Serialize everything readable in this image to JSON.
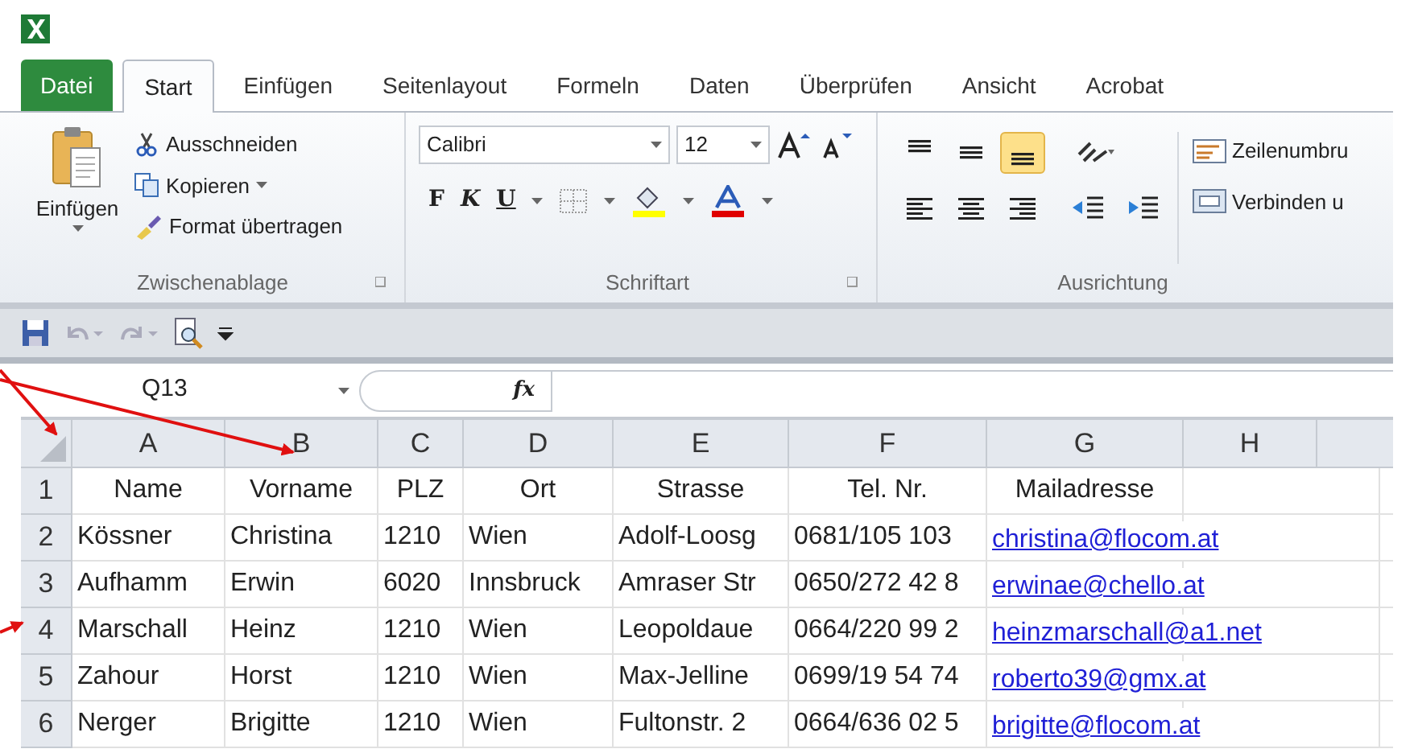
{
  "tabs": [
    {
      "label": "Datei",
      "kind": "file",
      "selected": false
    },
    {
      "label": "Start",
      "kind": "tab",
      "selected": true
    },
    {
      "label": "Einfügen",
      "kind": "tab",
      "selected": false
    },
    {
      "label": "Seitenlayout",
      "kind": "tab",
      "selected": false
    },
    {
      "label": "Formeln",
      "kind": "tab",
      "selected": false
    },
    {
      "label": "Daten",
      "kind": "tab",
      "selected": false
    },
    {
      "label": "Überprüfen",
      "kind": "tab",
      "selected": false
    },
    {
      "label": "Ansicht",
      "kind": "tab",
      "selected": false
    },
    {
      "label": "Acrobat",
      "kind": "tab",
      "selected": false
    }
  ],
  "clipboard": {
    "paste": "Einfügen",
    "cut": "Ausschneiden",
    "copy": "Kopieren",
    "format_painter": "Format übertragen",
    "label": "Zwischenablage"
  },
  "font": {
    "name": "Calibri",
    "size": "12",
    "bold": "F",
    "italic": "K",
    "underline": "U",
    "label": "Schriftart"
  },
  "alignment": {
    "vertical": [
      {
        "kind": "top",
        "selected": false
      },
      {
        "kind": "middle",
        "selected": false
      },
      {
        "kind": "bottom",
        "selected": true
      }
    ],
    "wrap": "Zeilenumbru",
    "merge": "Verbinden u",
    "label": "Ausrichtung"
  },
  "formula_bar": {
    "name_box": "Q13",
    "function_label": "fx"
  },
  "columns": [
    "A",
    "B",
    "C",
    "D",
    "E",
    "F",
    "G",
    "H"
  ],
  "rows": [
    {
      "number": "1",
      "kind": "header",
      "cells": [
        "Name",
        "Vorname",
        "PLZ",
        "Ort",
        "Strasse",
        "Tel. Nr.",
        "Mailadresse"
      ]
    },
    {
      "number": "2",
      "kind": "data",
      "cells": [
        "Kössner",
        "Christina",
        "1210",
        "Wien",
        "Adolf-Loosg",
        "0681/105 103",
        "christina@flocom.at"
      ]
    },
    {
      "number": "3",
      "kind": "data",
      "cells": [
        "Aufhamm",
        "Erwin",
        "6020",
        "Innsbruck",
        "Amraser Str",
        "0650/272 42 8",
        "erwinae@chello.at"
      ]
    },
    {
      "number": "4",
      "kind": "data",
      "cells": [
        "Marschall",
        "Heinz",
        "1210",
        "Wien",
        "Leopoldaue",
        "0664/220 99 2",
        "heinzmarschall@a1.net"
      ]
    },
    {
      "number": "5",
      "kind": "data",
      "cells": [
        "Zahour",
        "Horst",
        "1210",
        "Wien",
        "Max-Jelline",
        "0699/19 54 74",
        "roberto39@gmx.at"
      ]
    },
    {
      "number": "6",
      "kind": "data",
      "cells": [
        "Nerger",
        "Brigitte",
        "1210",
        "Wien",
        "Fultonstr. 2",
        "0664/636 02 5",
        "brigitte@flocom.at"
      ]
    }
  ]
}
